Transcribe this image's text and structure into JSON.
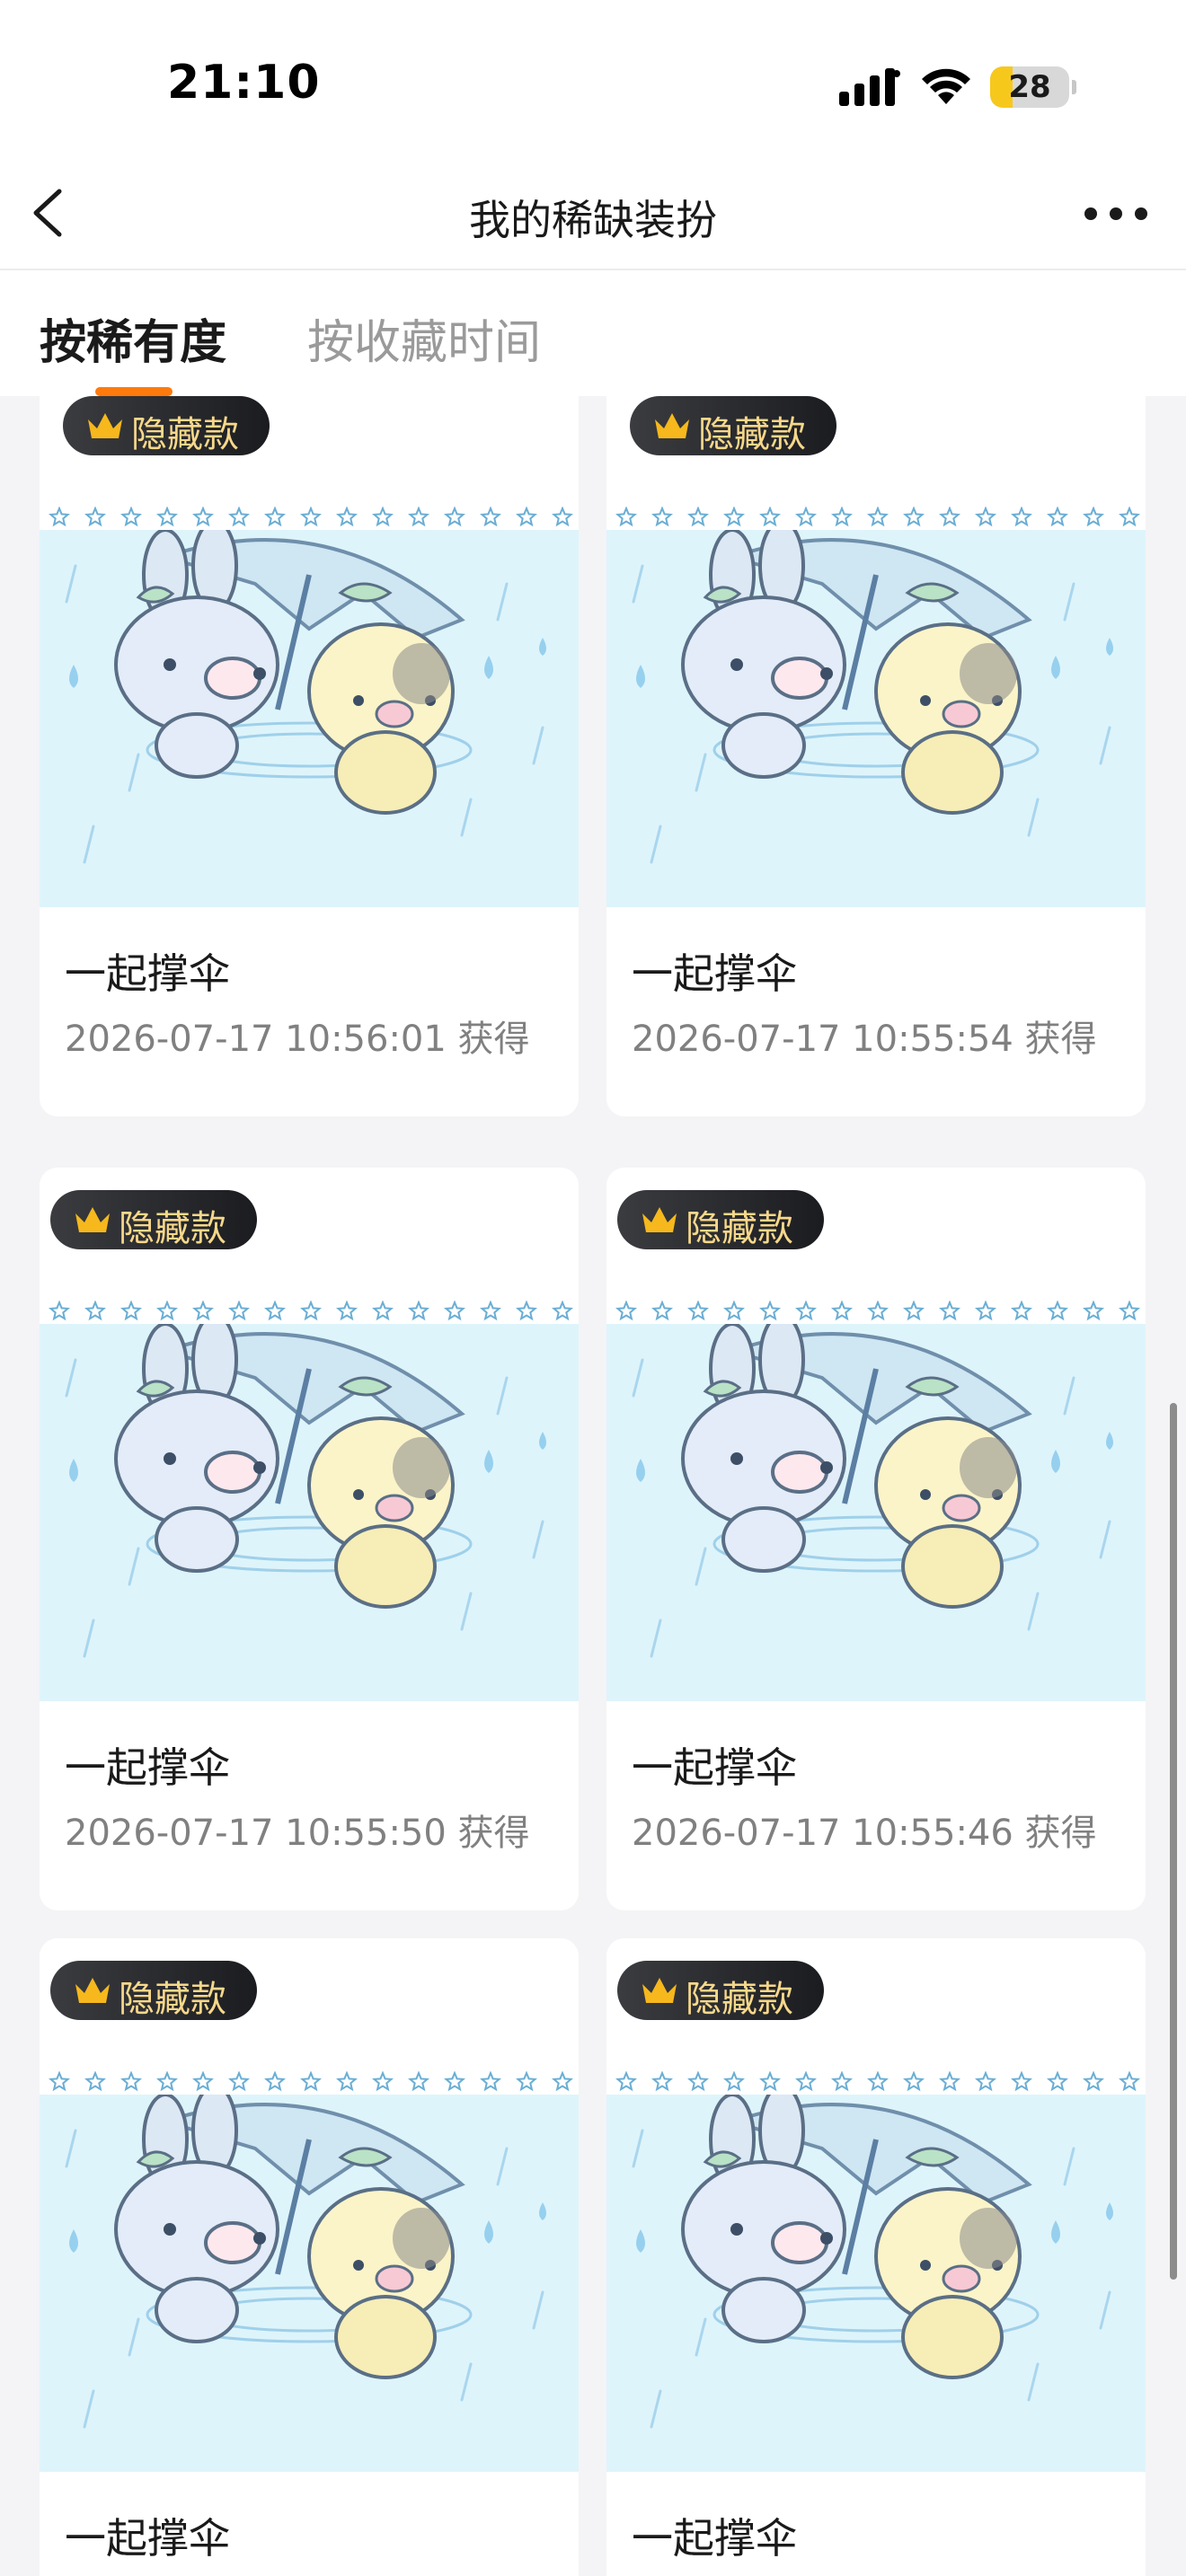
{
  "status_bar": {
    "time": "21:10",
    "battery_level": "28",
    "battery_fraction": 0.28
  },
  "nav": {
    "title": "我的稀缺装扮"
  },
  "tabs": [
    {
      "label": "按稀有度",
      "active": true
    },
    {
      "label": "按收藏时间",
      "active": false
    }
  ],
  "colors": {
    "accent": "#ff7a0d",
    "badge_text": "#f7d88a",
    "badge_bg": "#2a2b30",
    "image_bg": "#def4fb"
  },
  "items": [
    {
      "badge": "隐藏款",
      "name": "一起撑伞",
      "date": "2026-07-17 10:56:01 获得"
    },
    {
      "badge": "隐藏款",
      "name": "一起撑伞",
      "date": "2026-07-17 10:55:54 获得"
    },
    {
      "badge": "隐藏款",
      "name": "一起撑伞",
      "date": "2026-07-17 10:55:50 获得"
    },
    {
      "badge": "隐藏款",
      "name": "一起撑伞",
      "date": "2026-07-17 10:55:46 获得"
    },
    {
      "badge": "隐藏款",
      "name": "一起撑伞",
      "date": ""
    },
    {
      "badge": "隐藏款",
      "name": "一起撑伞",
      "date": ""
    }
  ]
}
